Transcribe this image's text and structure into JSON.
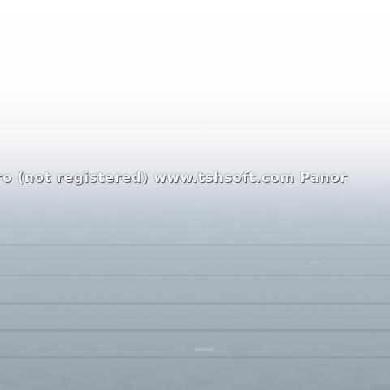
{
  "photo": {
    "subject": "hazy aerial landscape",
    "watermark_text": "ro (not registered) www.tshsoft.com  Panor"
  },
  "colors": {
    "sky": "#fdfdfd",
    "horizon_haze": "#d2d8e0",
    "land": "#a5b1bd",
    "land_dark": "#8e9da9"
  }
}
